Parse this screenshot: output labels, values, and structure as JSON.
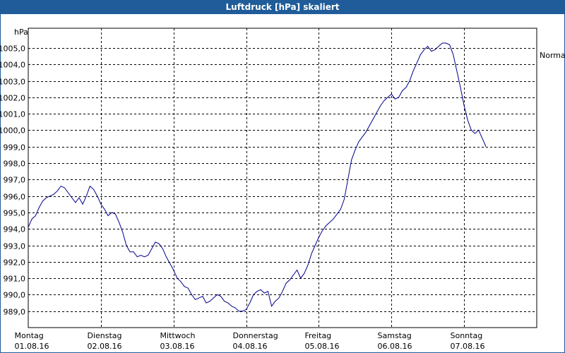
{
  "chart_data": {
    "type": "line",
    "title": "Luftdruck [hPa] skaliert",
    "ylabel": "hPa",
    "ylim": [
      988.0,
      1006.2
    ],
    "yticks": [
      "989,0",
      "990,0",
      "991,0",
      "992,0",
      "993,0",
      "994,0",
      "995,0",
      "996,0",
      "997,0",
      "998,0",
      "999,0",
      "1000,0",
      "1001,0",
      "1002,0",
      "1003,0",
      "1004,0",
      "1005,0"
    ],
    "yvalues": [
      989,
      990,
      991,
      992,
      993,
      994,
      995,
      996,
      997,
      998,
      999,
      1000,
      1001,
      1002,
      1003,
      1004,
      1005
    ],
    "days": [
      {
        "weekday": "Montag",
        "date": "01.08.16"
      },
      {
        "weekday": "Dienstag",
        "date": "02.08.16"
      },
      {
        "weekday": "Mittwoch",
        "date": "03.08.16"
      },
      {
        "weekday": "Donnerstag",
        "date": "04.08.16"
      },
      {
        "weekday": "Freitag",
        "date": "05.08.16"
      },
      {
        "weekday": "Samstag",
        "date": "06.08.16"
      },
      {
        "weekday": "Sonntag",
        "date": "07.08.16"
      }
    ],
    "normal_label": "Normal",
    "grid": true,
    "series_color": "#00008b",
    "x_days": [
      0,
      0.05,
      0.1,
      0.15,
      0.2,
      0.25,
      0.3,
      0.35,
      0.4,
      0.45,
      0.5,
      0.55,
      0.6,
      0.65,
      0.7,
      0.75,
      0.8,
      0.85,
      0.9,
      0.95,
      1.0,
      1.05,
      1.1,
      1.15,
      1.2,
      1.25,
      1.3,
      1.35,
      1.4,
      1.45,
      1.5,
      1.55,
      1.6,
      1.65,
      1.7,
      1.75,
      1.8,
      1.85,
      1.9,
      1.95,
      2.0,
      2.05,
      2.1,
      2.15,
      2.2,
      2.25,
      2.3,
      2.35,
      2.4,
      2.45,
      2.5,
      2.55,
      2.6,
      2.65,
      2.7,
      2.75,
      2.8,
      2.85,
      2.9,
      2.95,
      3.0,
      3.05,
      3.1,
      3.15,
      3.2,
      3.25,
      3.3,
      3.35,
      3.4,
      3.45,
      3.5,
      3.55,
      3.6,
      3.65,
      3.7,
      3.75,
      3.8,
      3.85,
      3.9,
      3.95,
      4.0,
      4.05,
      4.1,
      4.15,
      4.2,
      4.25,
      4.3,
      4.35,
      4.4,
      4.45,
      4.5,
      4.55,
      4.6,
      4.65,
      4.7,
      4.75,
      4.8,
      4.85,
      4.9,
      4.95,
      5.0,
      5.05,
      5.1,
      5.15,
      5.2,
      5.25,
      5.3,
      5.35,
      5.4,
      5.45,
      5.5,
      5.55,
      5.6,
      5.65,
      5.7,
      5.75,
      5.8,
      5.85,
      5.9,
      5.95,
      6.0,
      6.05,
      6.1,
      6.15,
      6.2,
      6.25,
      6.3,
      6.35,
      6.4,
      6.45,
      6.5,
      6.55,
      6.6,
      6.65,
      6.7,
      6.75,
      6.8,
      6.85,
      6.9,
      6.95,
      7.0
    ],
    "values": [
      994.1,
      994.6,
      994.8,
      995.3,
      995.7,
      995.9,
      996.0,
      996.1,
      996.3,
      996.6,
      996.5,
      996.2,
      995.9,
      995.6,
      995.9,
      995.5,
      996.0,
      996.6,
      996.4,
      996.0,
      995.5,
      995.2,
      994.8,
      995.0,
      994.9,
      994.4,
      993.8,
      993.0,
      992.6,
      992.6,
      992.3,
      992.4,
      992.3,
      992.4,
      992.8,
      993.2,
      993.1,
      992.8,
      992.3,
      991.9,
      991.5,
      991.0,
      990.8,
      990.5,
      990.4,
      990.0,
      989.7,
      989.8,
      989.9,
      989.5,
      989.6,
      989.8,
      990.0,
      989.9,
      989.6,
      989.5,
      989.3,
      989.2,
      989.0,
      989.0,
      989.1,
      989.5,
      990.0,
      990.2,
      990.3,
      990.1,
      990.2,
      989.3,
      989.6,
      989.8,
      990.2,
      990.7,
      990.9,
      991.2,
      991.5,
      991.0,
      991.3,
      991.8,
      992.5,
      993.0,
      993.5,
      993.9,
      994.2,
      994.4,
      994.6,
      994.9,
      995.2,
      995.8,
      997.0,
      998.2,
      998.8,
      999.3,
      999.6,
      999.9,
      1000.3,
      1000.7,
      1001.1,
      1001.5,
      1001.8,
      1002.0,
      1002.2,
      1001.9,
      1002.0,
      1002.4,
      1002.6,
      1003.0,
      1003.6,
      1004.1,
      1004.6,
      1004.9,
      1005.1,
      1004.8,
      1004.9,
      1005.1,
      1005.3,
      1005.3,
      1005.2,
      1004.6,
      1003.6,
      1002.6,
      1001.5,
      1000.6,
      1000.0,
      999.8,
      1000.0,
      999.5,
      999.0
    ]
  }
}
